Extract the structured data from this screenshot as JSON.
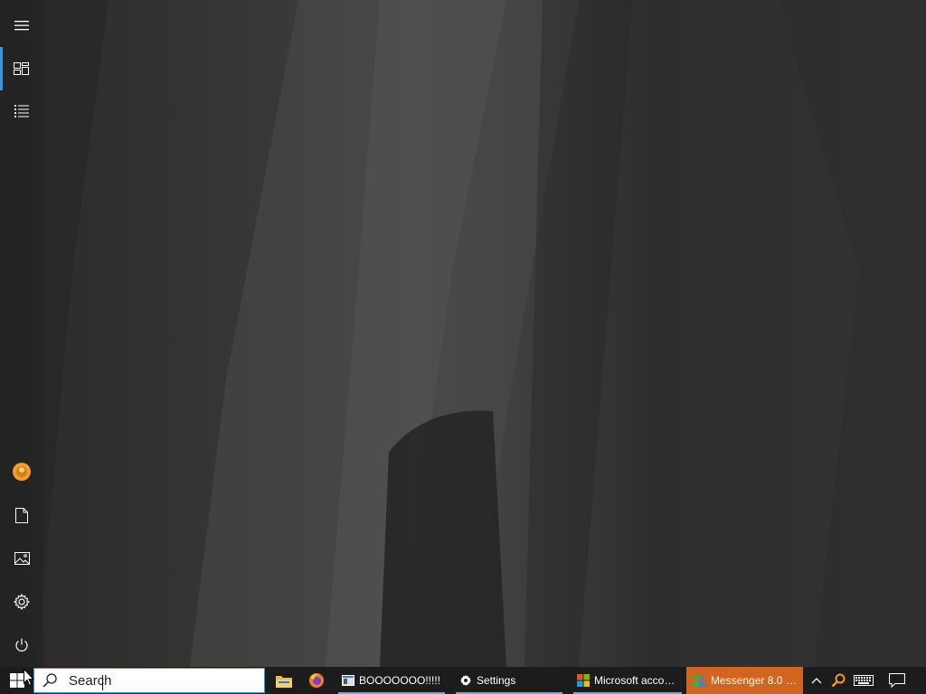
{
  "start_rail": {
    "items": [
      {
        "name": "hamburger-menu-icon"
      },
      {
        "name": "tiles-icon",
        "active": true
      },
      {
        "name": "all-apps-list-icon"
      },
      {
        "name": "user-avatar"
      },
      {
        "name": "documents-icon"
      },
      {
        "name": "pictures-icon"
      },
      {
        "name": "settings-gear-icon"
      },
      {
        "name": "power-icon"
      }
    ],
    "accent_color": "#3a96dd"
  },
  "taskbar": {
    "start_icon": "windows-logo-icon",
    "search": {
      "placeholder": "Search",
      "value": "",
      "icon": "search-icon"
    },
    "pinned": [
      {
        "name": "file-explorer-icon"
      },
      {
        "name": "firefox-icon"
      }
    ],
    "tasks": [
      {
        "label": "BOOOOOOO!!!!!",
        "icon": "app-window-icon"
      },
      {
        "label": "Settings",
        "icon": "settings-gear-icon"
      },
      {
        "label": "Microsoft accou...",
        "icon": "microsoft-logo-icon"
      },
      {
        "label": "Messenger 8.0 B...",
        "icon": "messenger-buddy-icon",
        "highlight_color": "#d1641f"
      }
    ],
    "tray": [
      {
        "name": "show-hidden-icons-chevron-icon"
      },
      {
        "name": "key-search-icon"
      },
      {
        "name": "touch-keyboard-icon"
      },
      {
        "name": "action-center-icon"
      }
    ]
  }
}
